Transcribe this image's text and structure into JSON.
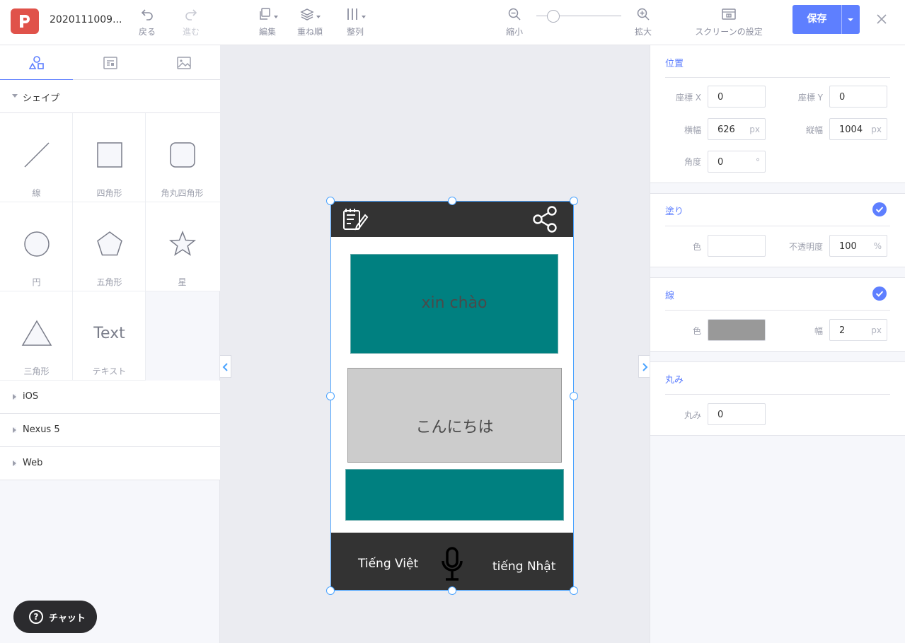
{
  "app": {
    "document_title": "2020111009...",
    "brand_color": "#e0524a",
    "accent_color": "#5e7fff"
  },
  "toolbar": {
    "undo": {
      "label": "戻る",
      "icon": "undo-icon"
    },
    "redo": {
      "label": "進む",
      "icon": "redo-icon"
    },
    "edit": {
      "label": "編集",
      "icon": "copy-icon"
    },
    "order": {
      "label": "重ね順",
      "icon": "layers-icon"
    },
    "align": {
      "label": "整列",
      "icon": "align-icon"
    },
    "zoom_out": {
      "label": "縮小",
      "icon": "zoom-out-icon"
    },
    "zoom_in": {
      "label": "拡大",
      "icon": "zoom-in-icon"
    },
    "screen_settings": {
      "label": "スクリーンの設定",
      "icon": "screen-settings-icon"
    },
    "save_label": "保存"
  },
  "left_panel": {
    "tabs": [
      {
        "name": "shapes",
        "icon": "shapes-icon",
        "active": true
      },
      {
        "name": "components",
        "icon": "component-icon",
        "active": false
      },
      {
        "name": "images",
        "icon": "image-icon",
        "active": false
      }
    ],
    "shapes_section": "シェイプ",
    "shapes": [
      {
        "label": "線",
        "icon": "line-shape-icon"
      },
      {
        "label": "四角形",
        "icon": "rectangle-shape-icon"
      },
      {
        "label": "角丸四角形",
        "icon": "rounded-rectangle-shape-icon"
      },
      {
        "label": "円",
        "icon": "circle-shape-icon"
      },
      {
        "label": "五角形",
        "icon": "pentagon-shape-icon"
      },
      {
        "label": "星",
        "icon": "star-shape-icon"
      },
      {
        "label": "三角形",
        "icon": "triangle-shape-icon"
      },
      {
        "label": "テキスト",
        "icon": "text-shape-icon",
        "glyph": "Text"
      }
    ],
    "collapsed_sections": [
      "iOS",
      "Nexus 5",
      "Web"
    ],
    "chat_label": "チャット"
  },
  "canvas": {
    "phone": {
      "header_color": "#333333",
      "box1_text": "xin chào",
      "box2_text": "こんにちは",
      "teal_color": "#008080",
      "grey_color": "#cccccc",
      "footer_left": "Tiếng Việt",
      "footer_right": "tiếng Nhật"
    }
  },
  "right_panel": {
    "position": {
      "title": "位置",
      "x_label": "座標 X",
      "x_value": "0",
      "y_label": "座標 Y",
      "y_value": "0",
      "w_label": "横幅",
      "w_value": "626",
      "w_unit": "px",
      "h_label": "縦幅",
      "h_value": "1004",
      "h_unit": "px",
      "angle_label": "角度",
      "angle_value": "0",
      "angle_unit": "°"
    },
    "fill": {
      "title": "塗り",
      "color_label": "色",
      "color_value": "#ffffff",
      "opacity_label": "不透明度",
      "opacity_value": "100",
      "opacity_unit": "%",
      "enabled": true
    },
    "stroke": {
      "title": "線",
      "color_label": "色",
      "color_value": "#999999",
      "width_label": "幅",
      "width_value": "2",
      "width_unit": "px",
      "enabled": true
    },
    "radius": {
      "title": "丸み",
      "label": "丸み",
      "value": "0"
    }
  }
}
